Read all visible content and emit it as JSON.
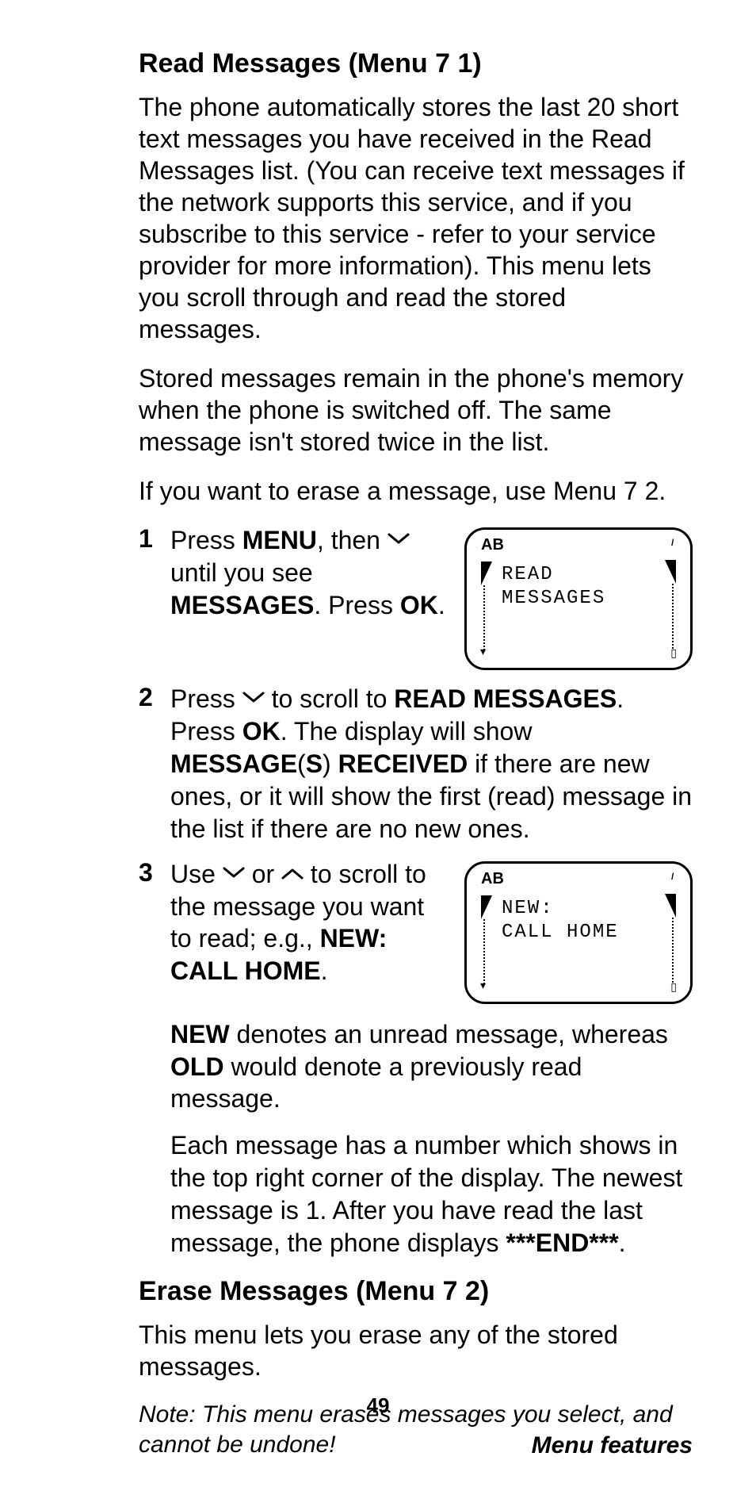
{
  "section1": {
    "title": "Read Messages (Menu 7 1)",
    "para1": "The phone automatically stores the last 20 short text messages you have received in the Read Messages list. (You can receive text messages if the network supports this service, and if you subscribe to this service - refer to your service provider for more information). This menu lets you scroll through and read the stored messages.",
    "para2": "Stored messages remain in the phone's memory when the phone is switched off. The same message isn't stored twice in the list.",
    "para3": "If you want to erase a message, use Menu 7 2."
  },
  "steps": [
    {
      "num": "1",
      "frag1": "Press ",
      "bold1": "MENU",
      "frag2": ", then ",
      "frag3": " until you see ",
      "bold2": "MESSAGES",
      "frag4": ". Press ",
      "bold3": "OK",
      "frag5": "."
    },
    {
      "num": "2",
      "frag1": "Press ",
      "frag2": " to scroll to ",
      "bold1": "READ MESSAGES",
      "frag3": ". Press ",
      "bold2": "OK",
      "frag4": ". The display will show ",
      "bold3": "MESSAGE",
      "frag5": "(",
      "bold4": "S",
      "frag6": ") ",
      "bold5": "RECEIVED",
      "frag7": " if there are new ones, or it will show the first (read) message in the list if there are no new ones."
    },
    {
      "num": "3",
      "frag1": "Use ",
      "frag_or": " or ",
      "frag2": " to scroll to the message you want to read; e.g., ",
      "bold1": "NEW: CALL HOME",
      "frag3": ".",
      "p2_a": "NEW",
      "p2_b": " denotes an unread message, whereas ",
      "p2_c": "OLD",
      "p2_d": " would denote a previously read message.",
      "p3_a": "Each message has a number which shows in the top right corner of the display. The newest message is 1. After you have read the last message, the phone displays ",
      "p3_b": "***END***",
      "p3_c": "."
    }
  ],
  "lcd1": {
    "ab": "AB",
    "line1": "READ",
    "line2": "MESSAGES"
  },
  "lcd2": {
    "ab": "AB",
    "line1": "NEW:",
    "line2": "CALL HOME"
  },
  "section2": {
    "title": "Erase Messages (Menu 7 2)",
    "para1": "This menu lets you erase any of the stored messages.",
    "note": "Note: This menu erases messages you select, and cannot be undone!"
  },
  "page_number": "49",
  "footer": "Menu features"
}
